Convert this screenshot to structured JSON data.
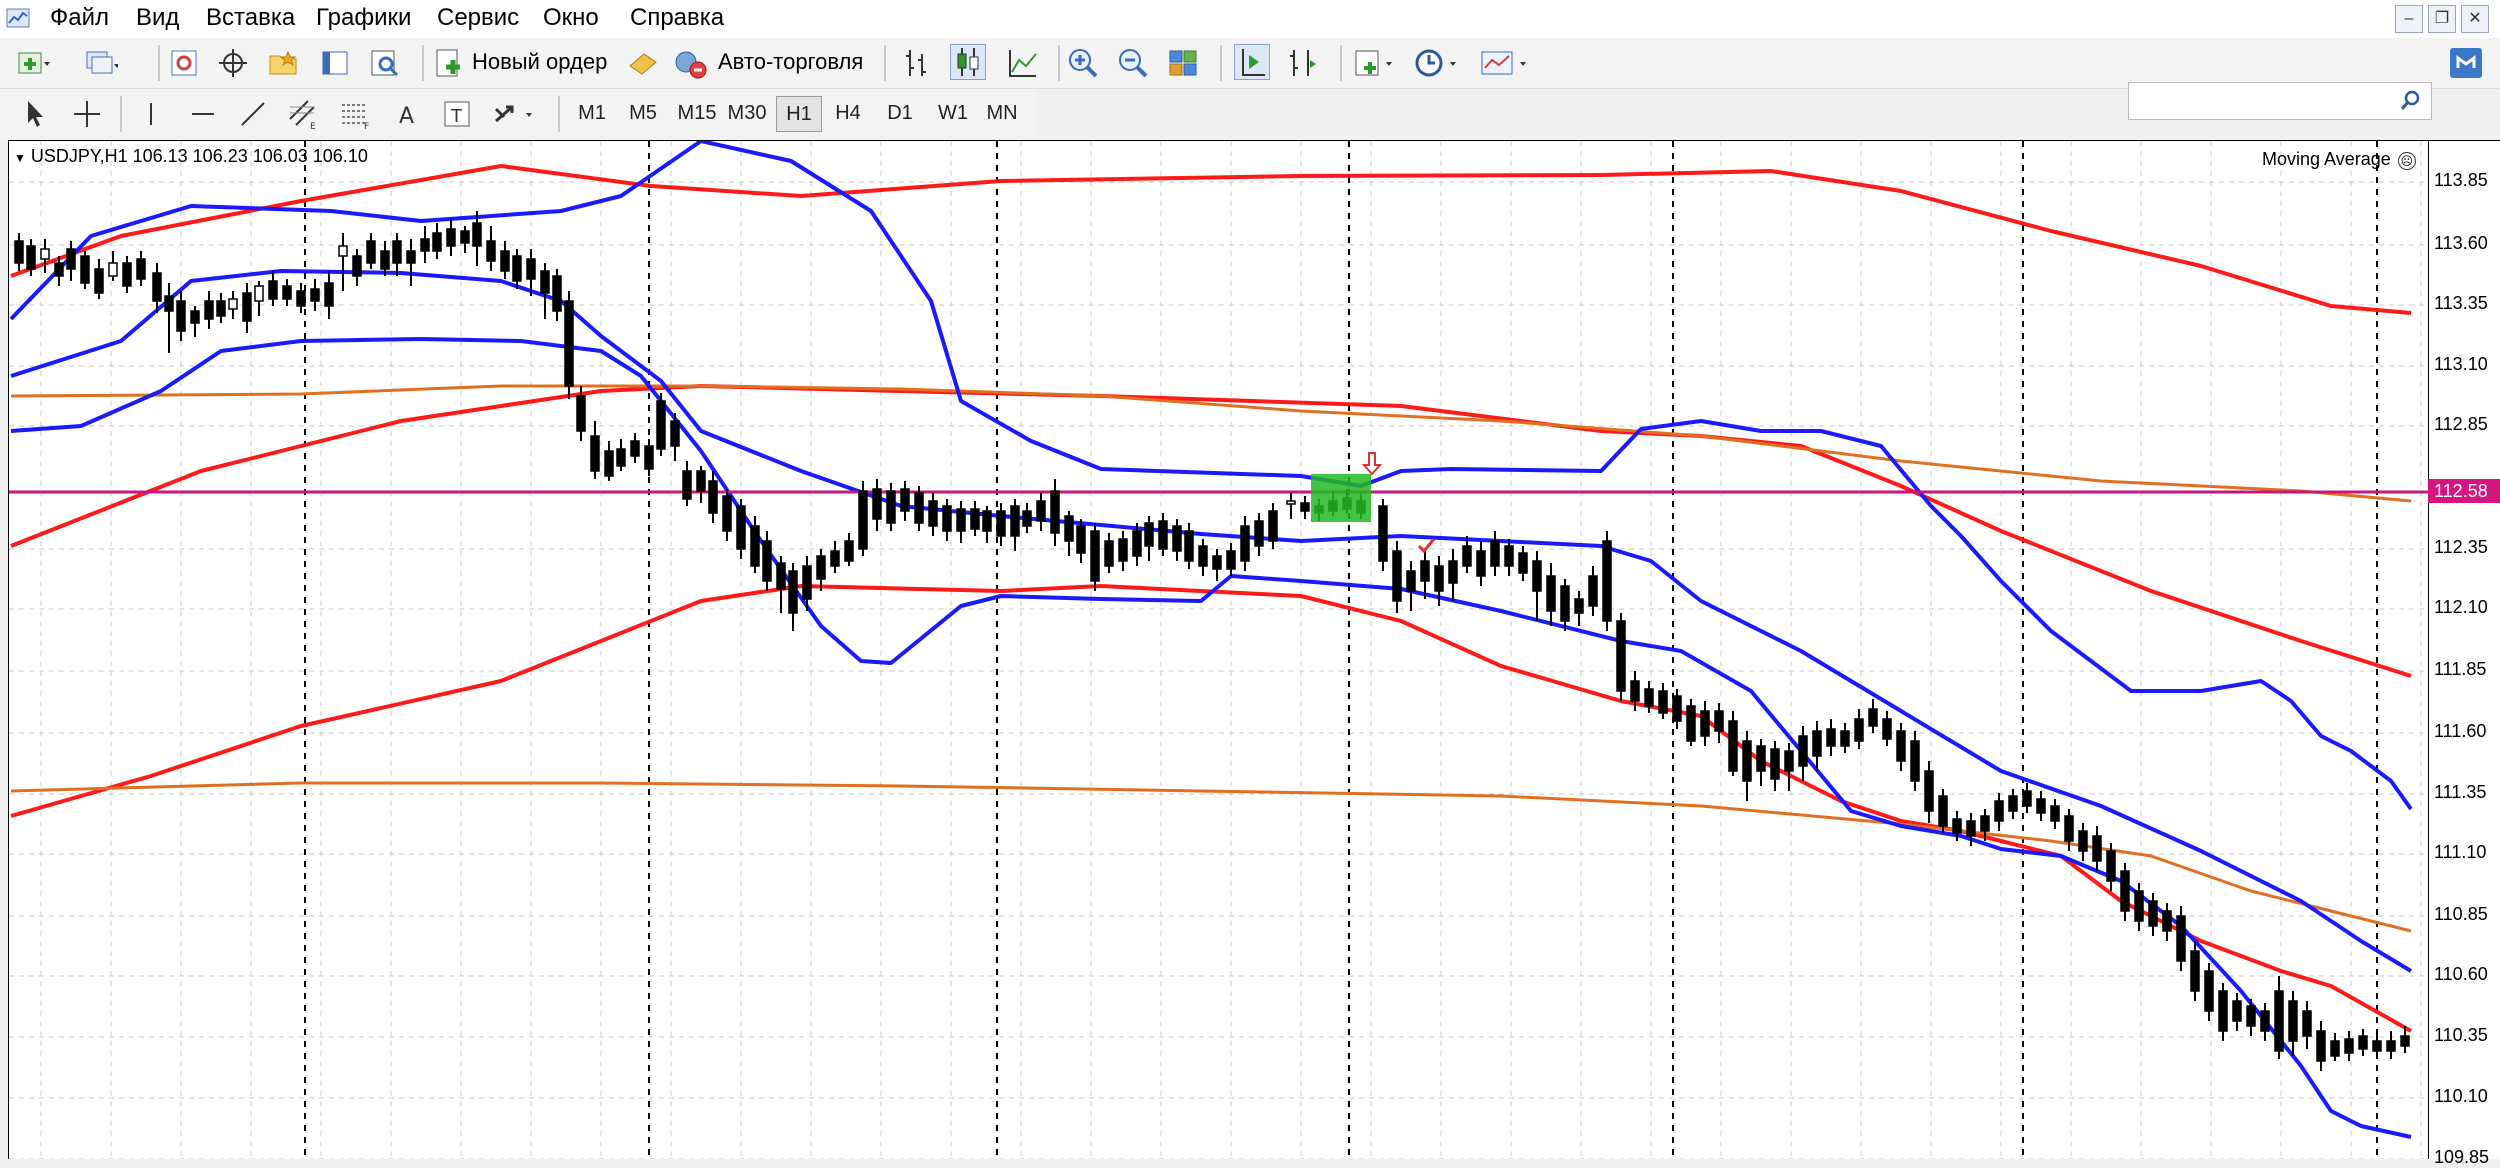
{
  "menubar": {
    "items": [
      "Файл",
      "Вид",
      "Вставка",
      "Графики",
      "Сервис",
      "Окно",
      "Справка"
    ]
  },
  "toolbar": {
    "new_order_label": "Новый ордер",
    "auto_trading_label": "Авто-торговля"
  },
  "timeframes": [
    "M1",
    "M5",
    "M15",
    "M30",
    "H1",
    "H4",
    "D1",
    "W1",
    "MN"
  ],
  "active_timeframe": "H1",
  "chart": {
    "title": "USDJPY,H1  106.13 106.23 106.03 106.10",
    "indicator_label": "Moving Average",
    "current_price": "112.58",
    "price_ticks": [
      "113.85",
      "113.60",
      "113.35",
      "113.10",
      "112.85",
      "112.35",
      "112.10",
      "111.85",
      "111.60",
      "111.35",
      "111.10",
      "110.85",
      "110.60",
      "110.35",
      "110.10",
      "109.85"
    ],
    "colors": {
      "bullish": "#ffffff",
      "bearish": "#000000",
      "bands_outer": "#ff1a1a",
      "bands_inner": "#1a1aff",
      "ma_long": "#e07020",
      "price_line": "#c8157f",
      "signal_highlight": "#22bb22"
    }
  }
}
